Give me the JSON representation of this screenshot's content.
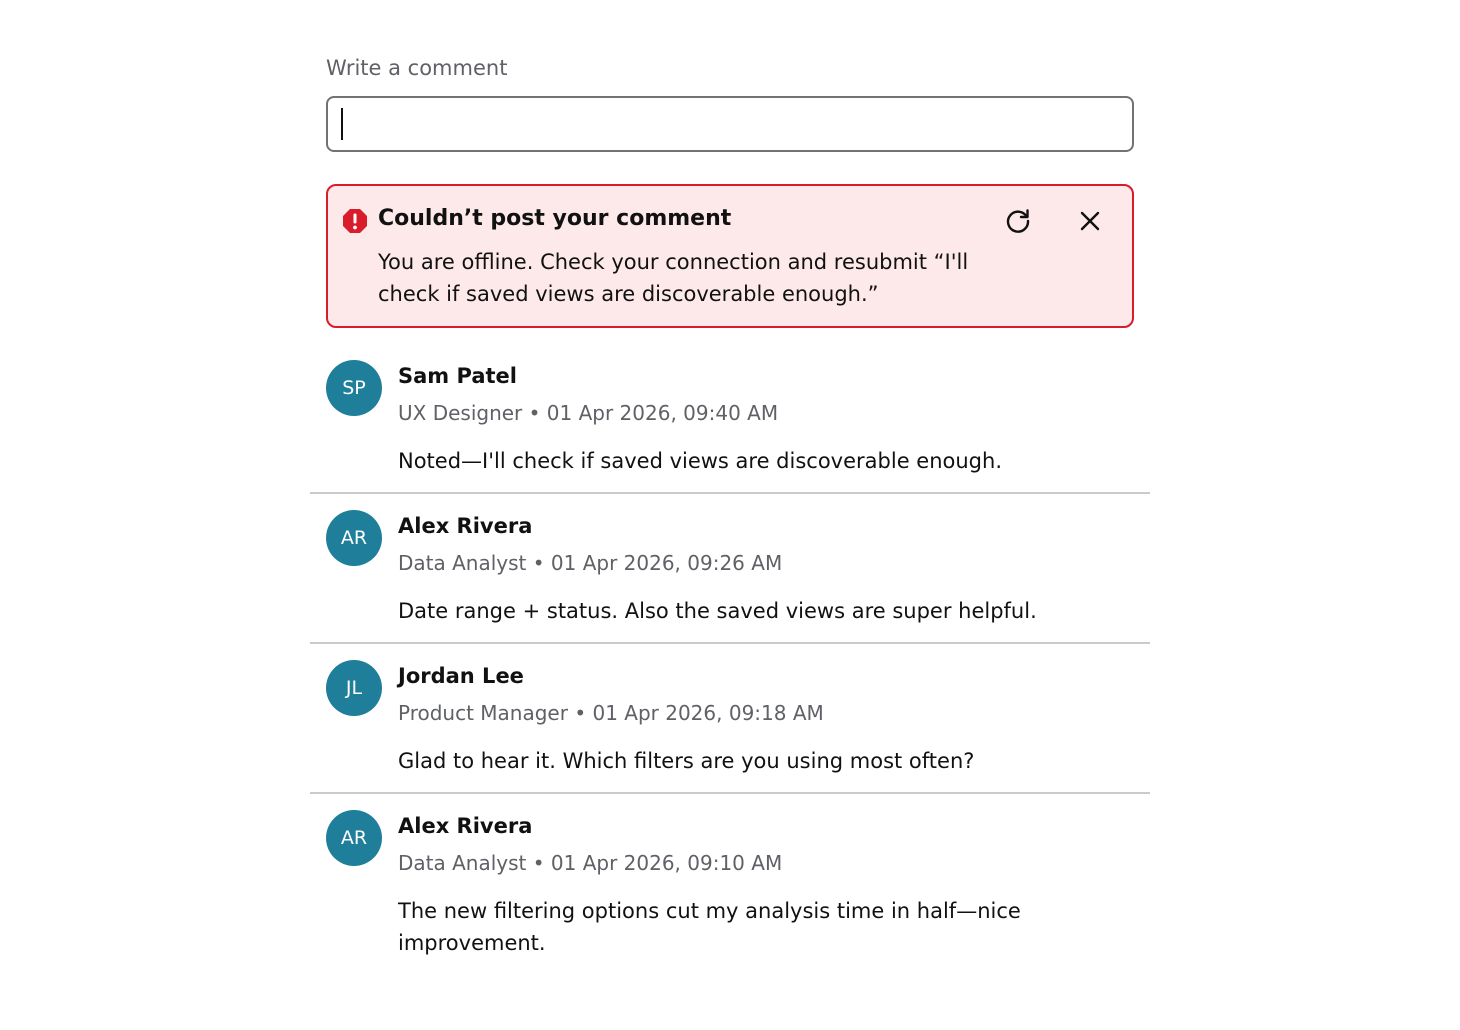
{
  "composer": {
    "label": "Write a comment",
    "value": "",
    "placeholder": ""
  },
  "alert": {
    "title": "Couldn’t post your comment",
    "message": "You are offline. Check your connection and resubmit “I'll check if saved views are discoverable enough.”",
    "icon": "error-octagon-icon",
    "retry_icon": "refresh-icon",
    "dismiss_icon": "close-icon",
    "color": "#d91c2a",
    "background": "#fde9ea"
  },
  "comments": [
    {
      "initials": "SP",
      "author": "Sam Patel",
      "role": "UX Designer",
      "timestamp": "01 Apr 2026, 09:40 AM",
      "meta": "UX Designer • 01 Apr 2026, 09:40 AM",
      "text": "Noted—I'll check if saved views are discoverable enough."
    },
    {
      "initials": "AR",
      "author": "Alex Rivera",
      "role": "Data Analyst",
      "timestamp": "01 Apr 2026, 09:26 AM",
      "meta": "Data Analyst • 01 Apr 2026, 09:26 AM",
      "text": "Date range + status. Also the saved views are super helpful."
    },
    {
      "initials": "JL",
      "author": "Jordan Lee",
      "role": "Product Manager",
      "timestamp": "01 Apr 2026, 09:18 AM",
      "meta": "Product Manager • 01 Apr 2026, 09:18 AM",
      "text": "Glad to hear it. Which filters are you using most often?"
    },
    {
      "initials": "AR",
      "author": "Alex Rivera",
      "role": "Data Analyst",
      "timestamp": "01 Apr 2026, 09:10 AM",
      "meta": "Data Analyst • 01 Apr 2026, 09:10 AM",
      "text": "The new filtering options cut my analysis time in half—nice improvement."
    }
  ],
  "colors": {
    "avatar": "#1f7f9b",
    "divider": "#c9cacc",
    "muted_text": "#5f6166"
  }
}
